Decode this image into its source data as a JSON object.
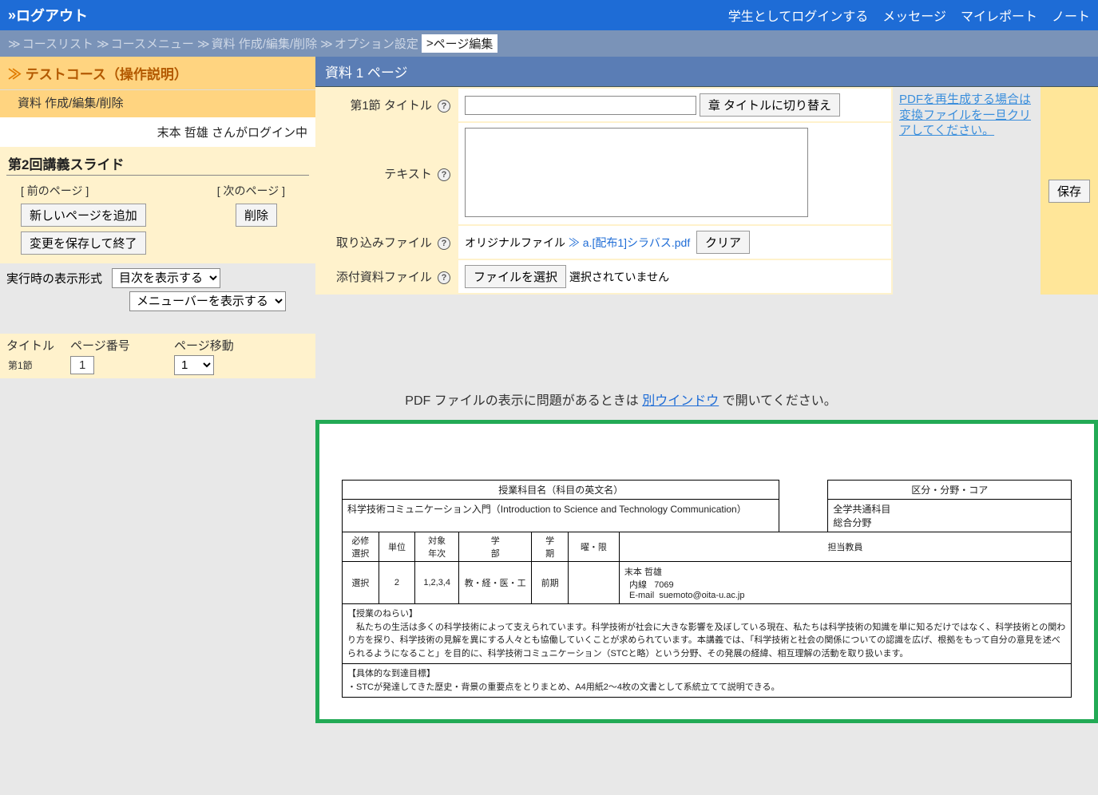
{
  "topbar": {
    "logout": "ログアウト",
    "student_login": "学生としてログインする",
    "messages": "メッセージ",
    "myreport": "マイレポート",
    "notes": "ノート"
  },
  "breadcrumb": {
    "items": [
      {
        "label": "コースリスト"
      },
      {
        "label": "コースメニュー"
      },
      {
        "label": "資料 作成/編集/削除"
      },
      {
        "label": "オプション設定"
      },
      {
        "label": "ページ編集",
        "active": true
      }
    ]
  },
  "sidebar": {
    "course_title": "テストコース（操作説明）",
    "course_sub": "資料 作成/編集/削除",
    "user_status": "末本 哲雄 さんがログイン中",
    "block_title": "第2回講義スライド",
    "prev_page": "[ 前のページ ]",
    "next_page": "[ 次のページ ]",
    "add_page_btn": "新しいページを追加",
    "delete_btn": "削除",
    "save_exit_btn": "変更を保存して終了",
    "runtime_label": "実行時の表示形式",
    "select_toc": "目次を表示する",
    "select_menu": "メニューバーを表示する",
    "title_label": "タイトル",
    "page_num_label": "ページ番号",
    "page_move_label": "ページ移動",
    "title_value": "第1節",
    "page_num_value": "1",
    "page_move_value": "1"
  },
  "content": {
    "header": "資料 1 ページ",
    "section_title_label": "第1節 タイトル",
    "chapter_switch_btn": "章 タイトルに切り替え",
    "text_label": "テキスト",
    "import_file_label": "取り込みファイル",
    "original_file_label": "オリジナルファイル",
    "file_link": "a.[配布1]シラバス.pdf",
    "clear_btn": "クリア",
    "attach_file_label": "添付資料ファイル",
    "choose_file_btn": "ファイルを選択",
    "no_file_selected": "選択されていません",
    "pdf_regen_note": "PDFを再生成する場合は変換ファイルを一旦クリアしてください。",
    "save_btn": "保存"
  },
  "pdf_note": {
    "prefix": "PDF ファイルの表示に問題があるときは ",
    "link": "別ウインドウ",
    "suffix": " で開いてください。"
  },
  "pdf": {
    "top_left_header": "授業科目名（科目の英文名）",
    "top_left_body": "科学技術コミュニケーション入門（Introduction to Science and Technology Communication）",
    "top_right_header": "区分・分野・コア",
    "top_right_body1": "全学共通科目",
    "top_right_body2": "総合分野",
    "cols": [
      "必修\n選択",
      "単位",
      "対象\n年次",
      "学\n部",
      "学\n期",
      "曜・限",
      "担当教員"
    ],
    "vals": [
      "選択",
      "2",
      "1,2,3,4",
      "教・経・医・工",
      "前期",
      "",
      ""
    ],
    "teacher_name": "末本 哲雄",
    "teacher_ext_label": "内線",
    "teacher_ext": "7069",
    "teacher_email_label": "E-mail",
    "teacher_email": "suemoto@oita-u.ac.jp",
    "aim_title": "【授業のねらい】",
    "aim_body": "　私たちの生活は多くの科学技術によって支えられています。科学技術が社会に大きな影響を及ぼしている現在、私たちは科学技術の知識を単に知るだけではなく、科学技術との関わり方を探り、科学技術の見解を異にする人々とも協働していくことが求められています。本講義では、「科学技術と社会の関係についての認識を広げ、根拠をもって自分の意見を述べられるようになること」を目的に、科学技術コミュニケーション（STCと略）という分野、その発展の経緯、相互理解の活動を取り扱います。",
    "goal_title": "【具体的な到達目標】",
    "goal_body": "・STCが発達してきた歴史・背景の重要点をとりまとめ、A4用紙2～4枚の文書として系統立てて説明できる。"
  }
}
